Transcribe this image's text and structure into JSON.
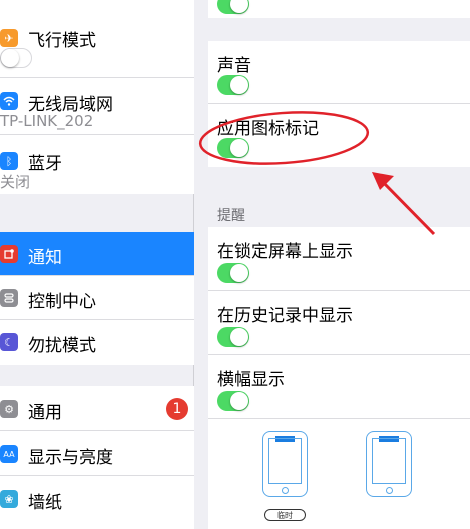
{
  "sidebar": {
    "group1": {
      "airplane": {
        "label": "飞行模式",
        "icon": "airplane-icon",
        "icon_color": "#f79a2c"
      },
      "wifi": {
        "label": "无线局域网",
        "value": "TP-LINK_202",
        "icon": "wifi-icon",
        "icon_color": "#1a85ff"
      },
      "bluetooth": {
        "label": "蓝牙",
        "value": "关闭",
        "icon": "bluetooth-icon",
        "icon_color": "#1a85ff"
      }
    },
    "group2": [
      {
        "label": "通知",
        "icon": "notification-icon",
        "icon_color": "#e53b30"
      },
      {
        "label": "控制中心",
        "icon": "control-center-icon",
        "icon_color": "#8e8e93"
      },
      {
        "label": "勿扰模式",
        "icon": "moon-icon",
        "icon_color": "#5856d6"
      }
    ],
    "group3": [
      {
        "label": "通用",
        "icon": "gear-icon",
        "icon_color": "#8e8e93",
        "badge": "1"
      },
      {
        "label": "显示与亮度",
        "icon": "display-icon",
        "icon_color": "#1a85ff"
      },
      {
        "label": "墙纸",
        "icon": "wallpaper-icon",
        "icon_color": "#34aadc"
      }
    ]
  },
  "detail": {
    "sounds_label": "声音",
    "badge_label": "应用图标标记",
    "alerts_header": "提醒",
    "lock_screen_label": "在锁定屏幕上显示",
    "history_label": "在历史记录中显示",
    "banner_label": "横幅显示",
    "banner_style_temporary": "临时"
  },
  "colors": {
    "accent": "#1a85ff",
    "toggle_on": "#4cd964",
    "annotation": "#e0222a"
  }
}
